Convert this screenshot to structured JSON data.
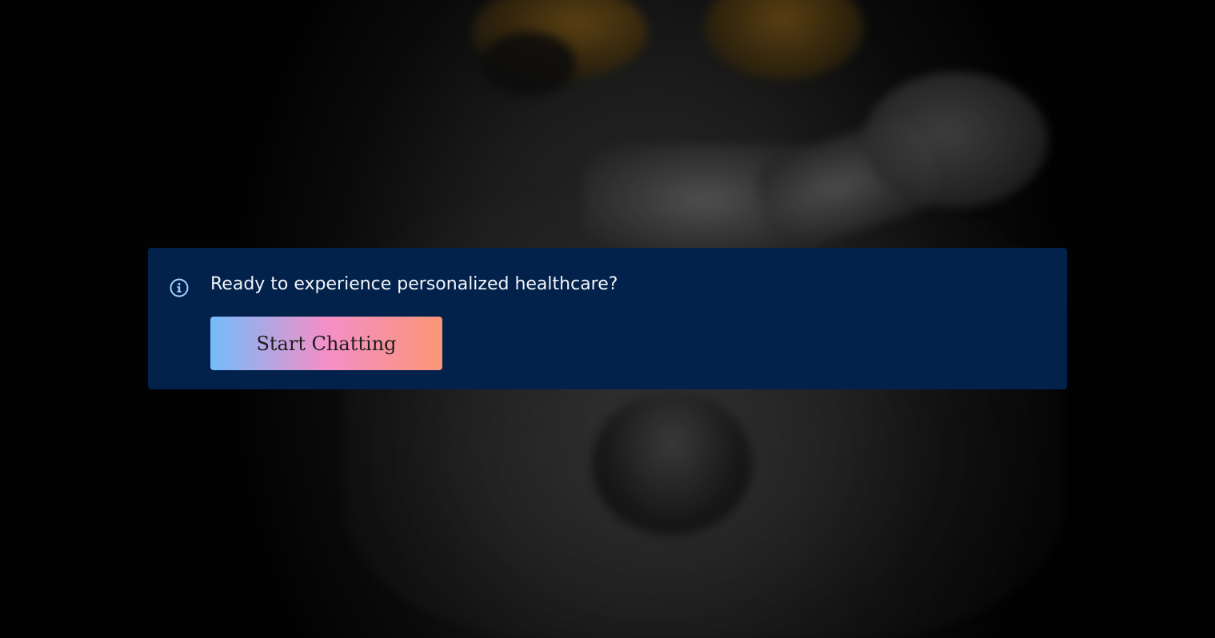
{
  "callout": {
    "message": "Ready to experience personalized healthcare?",
    "button_label": "Start Chatting",
    "icon": "info-icon"
  },
  "colors": {
    "callout_background": "#03224b",
    "message_text": "#f2f5fa",
    "info_icon": "#9fd0ff",
    "button_gradient_start": "#74bcfb",
    "button_gradient_mid": "#f48fc8",
    "button_gradient_end": "#fb9576"
  }
}
